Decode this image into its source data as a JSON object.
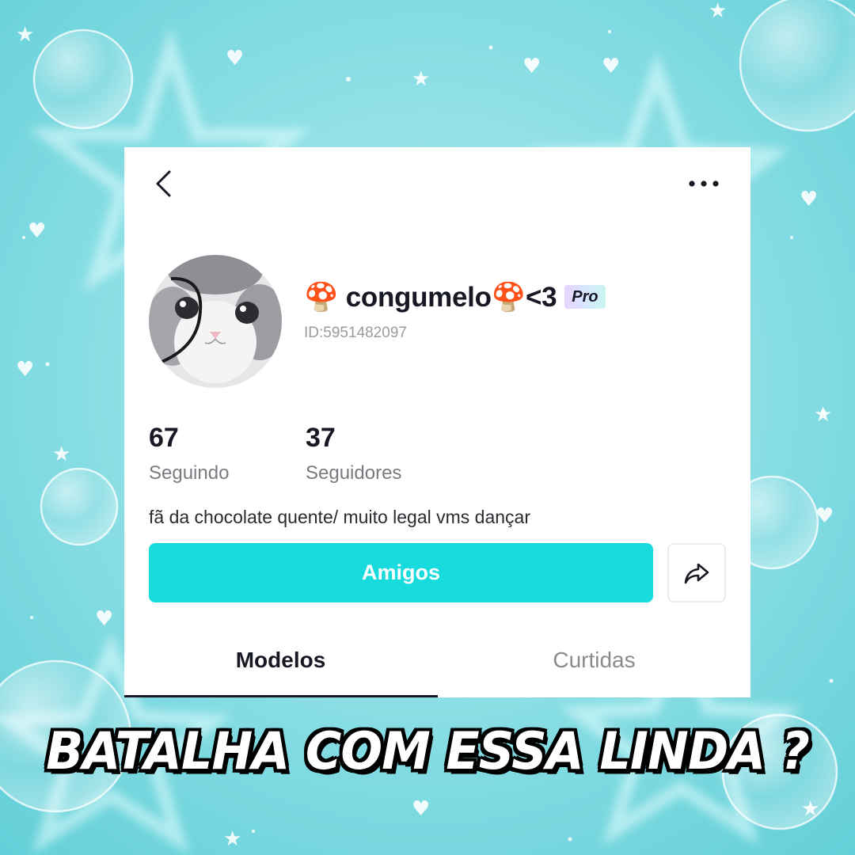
{
  "profile": {
    "username": "🍄 congumelo🍄<3",
    "pro_badge": "Pro",
    "user_id": "ID:5951482097",
    "bio": "fã da chocolate quente/ muito legal vms dançar"
  },
  "stats": {
    "following": {
      "value": "67",
      "label": "Seguindo"
    },
    "followers": {
      "value": "37",
      "label": "Seguidores"
    }
  },
  "actions": {
    "friends_label": "Amigos"
  },
  "tabs": [
    {
      "label": "Modelos",
      "active": true
    },
    {
      "label": "Curtidas",
      "active": false
    }
  ],
  "caption": "BATALHA COM ESSA LINDA ?",
  "icons": {
    "back": "chevron-left-icon",
    "more": "more-dots-icon",
    "share": "share-arrow-icon"
  },
  "colors": {
    "accent": "#17dbdd",
    "background": "#8fe0e6"
  }
}
